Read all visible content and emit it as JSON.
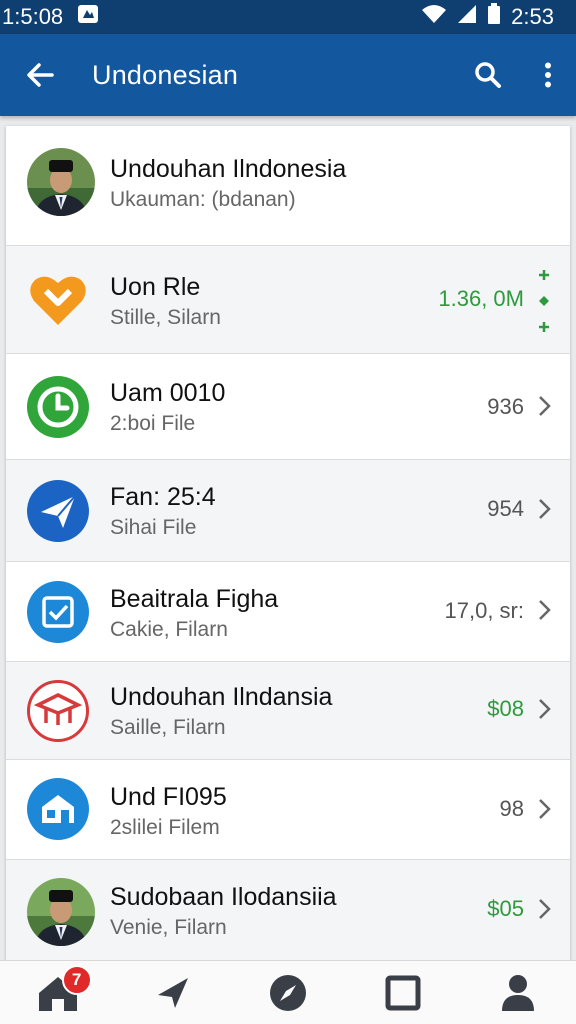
{
  "status_bar": {
    "time_left": "1:5:08",
    "time_right": "2:53"
  },
  "app_bar": {
    "title": "Undonesian"
  },
  "contacts": [
    {
      "type": "avatar",
      "name": "Undouhan Ilndonesia",
      "subtitle": "Ukauman: (bdanan)",
      "value": "",
      "value_color": "",
      "chevron": false
    },
    {
      "type": "heart-icon",
      "name": "Uon Rle",
      "subtitle": "Stille, Silarn",
      "value": "1.36, 0M",
      "value_color": "green",
      "chevron": false
    },
    {
      "type": "clock-icon",
      "name": "Uam 0010",
      "subtitle": "2:boi File",
      "value": "936",
      "value_color": "gray",
      "chevron": true
    },
    {
      "type": "send-icon",
      "name": "Fan: 25:4",
      "subtitle": "Sihai File",
      "value": "954",
      "value_color": "gray",
      "chevron": true
    },
    {
      "type": "check-icon",
      "name": "Beaitrala Figha",
      "subtitle": "Cakie, Filarn",
      "value": "17,0, sr:",
      "value_color": "gray",
      "chevron": true
    },
    {
      "type": "graduation-icon",
      "name": "Undouhan Ilndansia",
      "subtitle": "Saille, Filarn",
      "value": "$08",
      "value_color": "green",
      "chevron": true
    },
    {
      "type": "store-icon",
      "name": "Und FI095",
      "subtitle": "2slilei Filem",
      "value": "98",
      "value_color": "gray",
      "chevron": true
    },
    {
      "type": "avatar",
      "name": "Sudobaan Ilodansiia",
      "subtitle": "Venie, Filarn",
      "value": "$05",
      "value_color": "green",
      "chevron": true
    }
  ],
  "bottom_nav": {
    "home_badge": "7"
  },
  "colors": {
    "status_bar": "#0f3e70",
    "app_bar": "#13579e",
    "green_value": "#2e9a3e",
    "badge": "#e02a2a"
  }
}
